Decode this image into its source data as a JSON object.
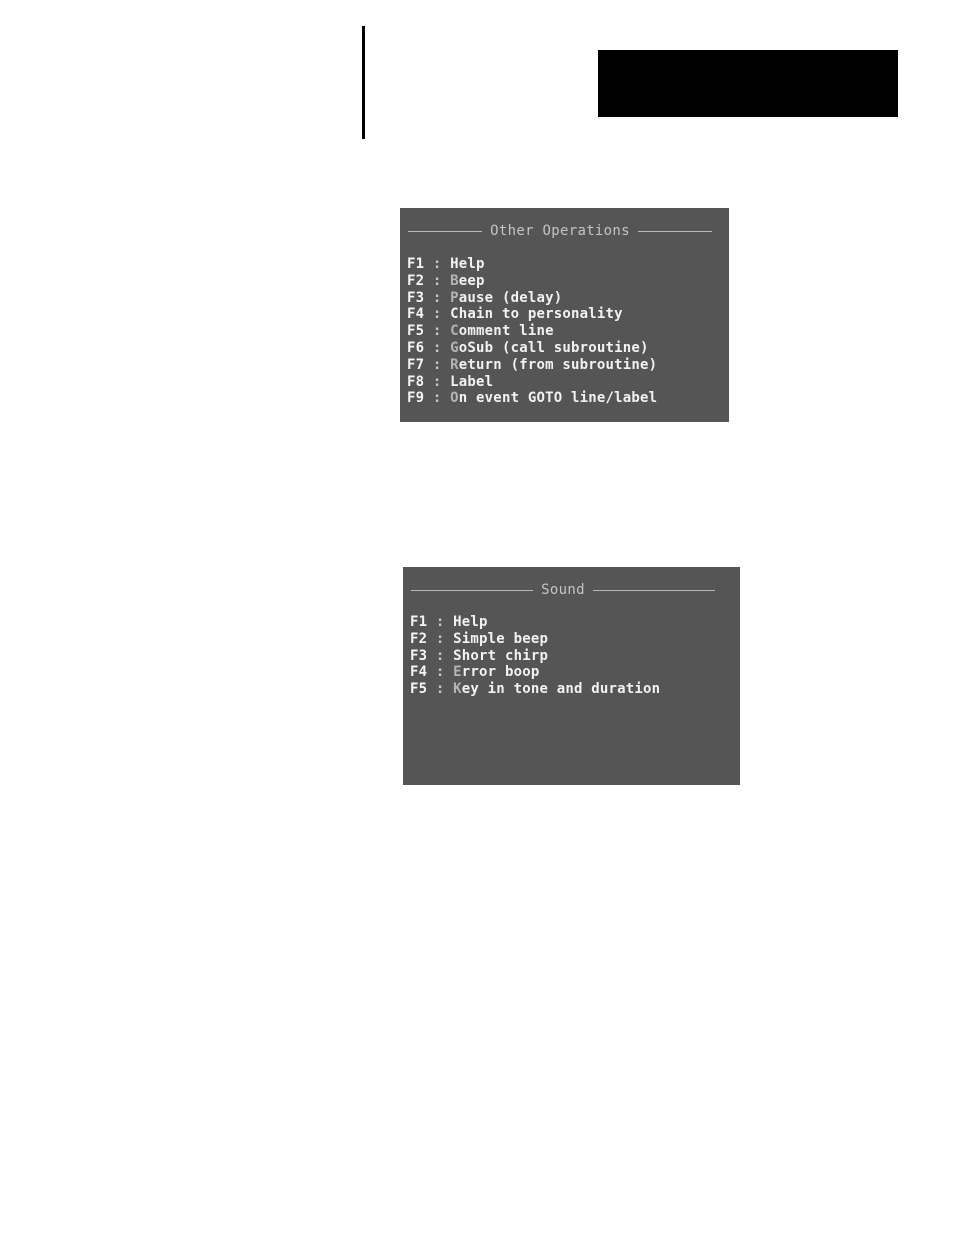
{
  "colors": {
    "screen_bg": "#555555",
    "text": "#f2f2f2",
    "hotkey_letter": "#b4b4b4",
    "title_text": "#c4c4c4",
    "page_bg": "#ffffff",
    "header_block": "#000000"
  },
  "other_operations": {
    "title": "Other Operations",
    "items": [
      {
        "key": "F1",
        "sep": " : ",
        "hot": "H",
        "rest": "elp",
        "hot_dim": false
      },
      {
        "key": "F2",
        "sep": " : ",
        "hot": "B",
        "rest": "eep",
        "hot_dim": true
      },
      {
        "key": "F3",
        "sep": " : ",
        "hot": "P",
        "rest": "ause (delay)",
        "hot_dim": true
      },
      {
        "key": "F4",
        "sep": " : ",
        "hot": "C",
        "rest": "hain to personality",
        "hot_dim": false
      },
      {
        "key": "F5",
        "sep": " : ",
        "hot": "C",
        "rest": "omment line",
        "hot_dim": true
      },
      {
        "key": "F6",
        "sep": " : ",
        "hot": "G",
        "rest": "oSub (call subroutine)",
        "hot_dim": true
      },
      {
        "key": "F7",
        "sep": " : ",
        "hot": "R",
        "rest": "eturn (from subroutine)",
        "hot_dim": true
      },
      {
        "key": "F8",
        "sep": " : ",
        "hot": "L",
        "rest": "abel",
        "hot_dim": false
      },
      {
        "key": "F9",
        "sep": " : ",
        "hot": "O",
        "rest": "n event GOTO line/label",
        "hot_dim": true
      }
    ]
  },
  "sound": {
    "title": "Sound",
    "items": [
      {
        "key": "F1",
        "sep": " : ",
        "hot": "H",
        "rest": "elp",
        "hot_dim": false
      },
      {
        "key": "F2",
        "sep": " : ",
        "hot": "S",
        "rest": "imple beep",
        "hot_dim": false
      },
      {
        "key": "F3",
        "sep": " : ",
        "hot": "S",
        "rest": "hort chirp",
        "hot_dim": false
      },
      {
        "key": "F4",
        "sep": " : ",
        "hot": "E",
        "rest": "rror boop",
        "hot_dim": true
      },
      {
        "key": "F5",
        "sep": " : ",
        "hot": "K",
        "rest": "ey in tone and duration",
        "hot_dim": true
      }
    ]
  }
}
